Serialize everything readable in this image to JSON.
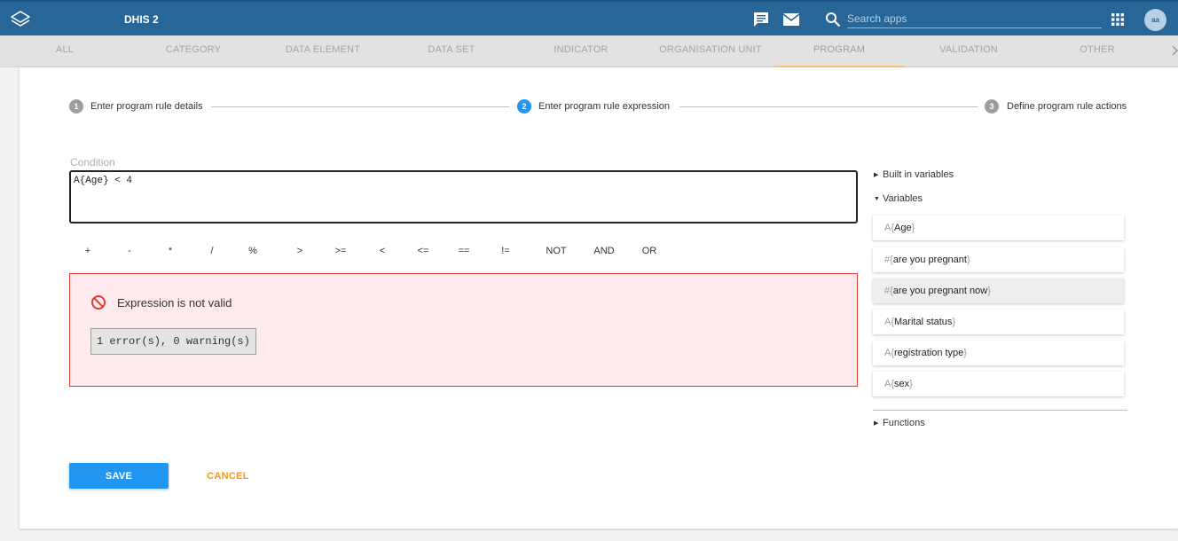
{
  "header": {
    "app_title": "DHIS 2",
    "search_placeholder": "Search apps",
    "avatar_initials": "aa",
    "bg_color": "#276696"
  },
  "tabs": [
    "ALL",
    "CATEGORY",
    "DATA ELEMENT",
    "DATA SET",
    "INDICATOR",
    "ORGANISATION UNIT",
    "PROGRAM",
    "VALIDATION",
    "OTHER"
  ],
  "active_tab": "PROGRAM",
  "stepper": {
    "steps": [
      {
        "number": "1",
        "label": "Enter program rule details",
        "state": "inactive"
      },
      {
        "number": "2",
        "label": "Enter program rule expression",
        "state": "active"
      },
      {
        "number": "3",
        "label": "Define program rule actions",
        "state": "inactive"
      }
    ],
    "active_color": "#2196f3",
    "inactive_color": "#9e9e9e"
  },
  "condition": {
    "label": "Condition",
    "value": "A{Age} < 4"
  },
  "operators": [
    "+",
    "-",
    "*",
    "/",
    "%",
    ">",
    ">=",
    "<",
    "<=",
    "==",
    "!=",
    "NOT",
    "AND",
    "OR"
  ],
  "error": {
    "message": "Expression is not valid",
    "summary": "1 error(s), 0 warning(s)",
    "color": "#e53935"
  },
  "panel": {
    "built_in_label": "Built in variables",
    "variables_label": "Variables",
    "functions_label": "Functions",
    "variables": [
      {
        "prefix": "A{",
        "name": "Age",
        "suffix": "}"
      },
      {
        "prefix": "#{",
        "name": "are you pregnant",
        "suffix": "}"
      },
      {
        "prefix": "#{",
        "name": "are you pregnant now",
        "suffix": "}"
      },
      {
        "prefix": "A{",
        "name": "Marital status",
        "suffix": "}"
      },
      {
        "prefix": "A{",
        "name": "registration type",
        "suffix": "}"
      },
      {
        "prefix": "A{",
        "name": "sex",
        "suffix": "}"
      }
    ]
  },
  "actions": {
    "save_label": "SAVE",
    "cancel_label": "CANCEL",
    "save_color": "#2196f3",
    "cancel_color": "#ff9800"
  }
}
